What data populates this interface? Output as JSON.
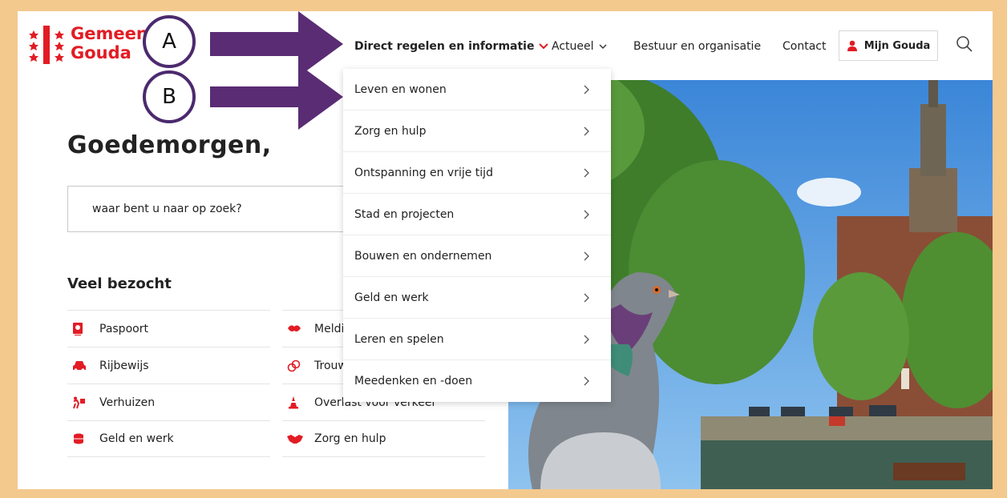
{
  "logo": {
    "line1": "Gemeente",
    "line2": "Gouda"
  },
  "nav": {
    "items": [
      {
        "label": "Direct regelen en informatie",
        "active": true
      },
      {
        "label": "Actueel"
      },
      {
        "label": "Bestuur en organisatie"
      },
      {
        "label": "Contact"
      }
    ],
    "mijn_label": "Mijn Gouda"
  },
  "main": {
    "greeting": "Goedemorgen,",
    "search_placeholder": "waar bent u naar op zoek?",
    "veel_title": "Veel bezocht",
    "left_links": [
      {
        "label": "Paspoort",
        "icon": "passport-icon"
      },
      {
        "label": "Rijbewijs",
        "icon": "car-icon"
      },
      {
        "label": "Verhuizen",
        "icon": "moving-icon"
      },
      {
        "label": "Geld en werk",
        "icon": "coins-icon"
      }
    ],
    "right_links": [
      {
        "label": "Melding",
        "icon": "bird-icon"
      },
      {
        "label": "Trouwen",
        "icon": "rings-icon"
      },
      {
        "label": "Overlast voor verkeer",
        "icon": "traffic-cone-icon"
      },
      {
        "label": "Zorg en hulp",
        "icon": "handshake-icon"
      }
    ]
  },
  "dropdown": {
    "items": [
      "Leven en wonen",
      "Zorg en hulp",
      "Ontspanning en vrije tijd",
      "Stad en projecten",
      "Bouwen en ondernemen",
      "Geld en werk",
      "Leren en spelen",
      "Meedenken en -doen"
    ]
  },
  "annotations": {
    "a": "A",
    "b": "B"
  },
  "colors": {
    "brand_red": "#e21c24",
    "annotation_purple": "#5a2c74",
    "frame_border": "#f3c98e"
  }
}
